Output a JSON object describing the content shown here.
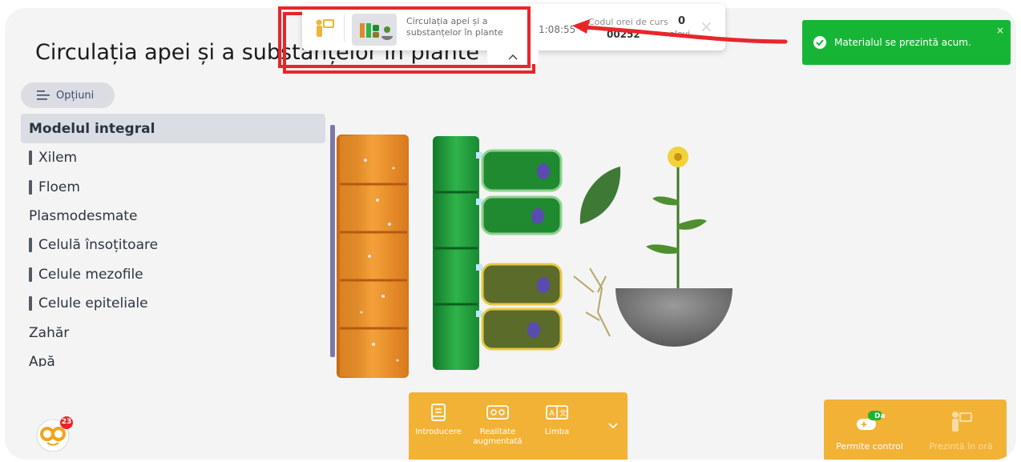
{
  "lesson_title": "Circulația apei și a substanțelor în plante",
  "options_label": "Opțiuni",
  "menu": {
    "items": [
      {
        "label": "Modelul integral",
        "active": true,
        "bar": false
      },
      {
        "label": "Xilem",
        "active": false,
        "bar": true
      },
      {
        "label": "Floem",
        "active": false,
        "bar": true
      },
      {
        "label": "Plasmodesmate",
        "active": false,
        "bar": false
      },
      {
        "label": "Celulă însoțitoare",
        "active": false,
        "bar": true
      },
      {
        "label": "Celule mezofile",
        "active": false,
        "bar": true
      },
      {
        "label": "Celule epiteliale",
        "active": false,
        "bar": true
      },
      {
        "label": "Zahăr",
        "active": false,
        "bar": false
      },
      {
        "label": "Apă",
        "active": false,
        "bar": false
      }
    ]
  },
  "notification": {
    "count": "23"
  },
  "toolbar": {
    "items": [
      {
        "label": "Introducere",
        "icon": "book-icon"
      },
      {
        "label": "Realitate augmentată",
        "icon": "ar-glasses-icon"
      },
      {
        "label": "Limba",
        "icon": "translate-icon"
      }
    ],
    "more_icon": "chevron-down-icon"
  },
  "controls": {
    "allow_control": {
      "label": "Permite control",
      "badge": "Da"
    },
    "present": {
      "label": "Prezintă în oră"
    }
  },
  "toast": {
    "message": "Materialul se prezintă acum.",
    "close": "×"
  },
  "session_popup": {
    "lesson_name": "Circulația apei și a substanțelor în plante",
    "timer": "1:08:55",
    "code_label": "Codul orei de curs",
    "code": "00252",
    "students_count": "0",
    "students_label": "elevi",
    "close": "×"
  },
  "colors": {
    "accent": "#f2b235",
    "toast": "#17b535",
    "highlight": "#e8262a",
    "menu_active": "#dadde4",
    "scroll": "#7a79a8"
  }
}
